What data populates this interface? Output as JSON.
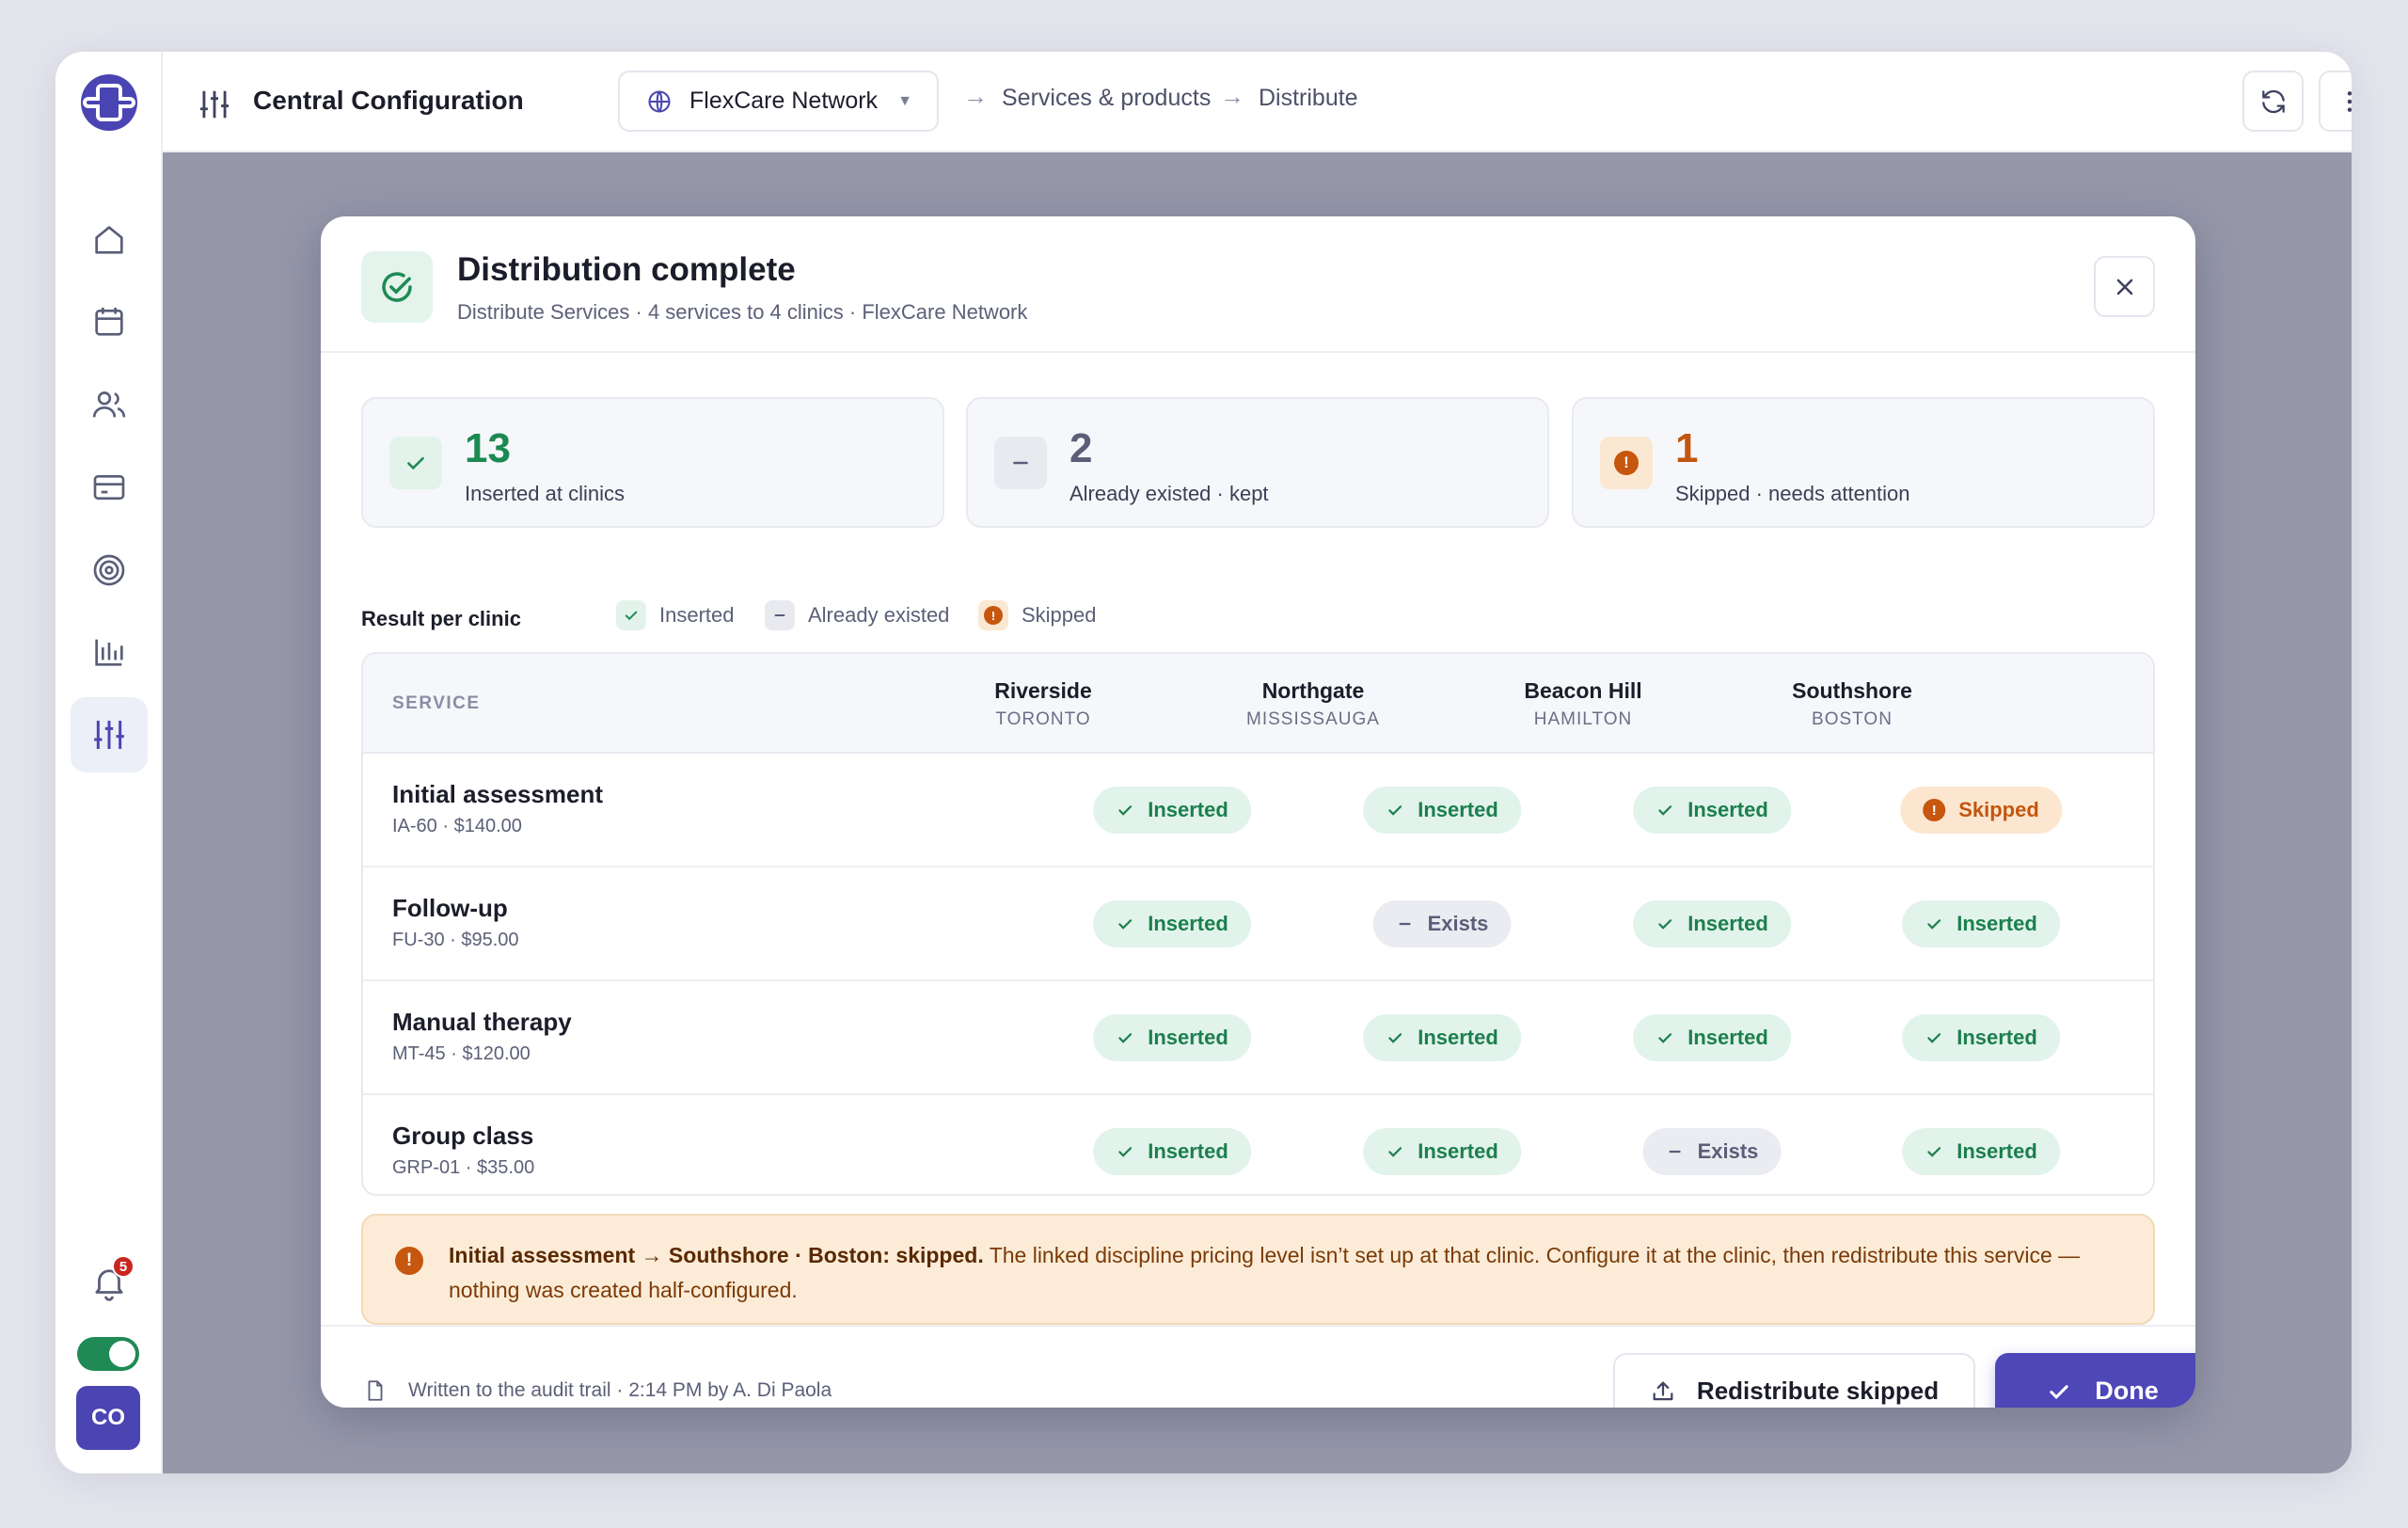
{
  "sidebar": {
    "notification_count": "5",
    "avatar_initials": "CO"
  },
  "topbar": {
    "title": "Central Configuration",
    "network": "FlexCare Network",
    "breadcrumb": [
      "Services & products",
      "Distribute"
    ]
  },
  "modal": {
    "title": "Distribution complete",
    "subtitle": "Distribute Services · 4 services to 4 clinics · FlexCare Network",
    "stats": [
      {
        "value": "13",
        "label": "Inserted at clinics",
        "color": "#1b8a52"
      },
      {
        "value": "2",
        "label": "Already existed · kept",
        "color": "#5a5e78"
      },
      {
        "value": "1",
        "label": "Skipped · needs attention",
        "color": "#c2560e"
      }
    ],
    "legend": {
      "title": "Result per clinic",
      "inserted": "Inserted",
      "exists": "Already existed",
      "skipped": "Skipped"
    },
    "table": {
      "service_header": "SERVICE",
      "clinics": [
        {
          "name": "Riverside",
          "city": "TORONTO"
        },
        {
          "name": "Northgate",
          "city": "MISSISSAUGA"
        },
        {
          "name": "Beacon Hill",
          "city": "HAMILTON"
        },
        {
          "name": "Southshore",
          "city": "BOSTON"
        }
      ],
      "rows": [
        {
          "name": "Initial assessment",
          "meta": "IA-60 · $140.00",
          "results": [
            "Inserted",
            "Inserted",
            "Inserted",
            "Skipped"
          ]
        },
        {
          "name": "Follow-up",
          "meta": "FU-30 · $95.00",
          "results": [
            "Inserted",
            "Exists",
            "Inserted",
            "Inserted"
          ]
        },
        {
          "name": "Manual therapy",
          "meta": "MT-45 · $120.00",
          "results": [
            "Inserted",
            "Inserted",
            "Inserted",
            "Inserted"
          ]
        },
        {
          "name": "Group class",
          "meta": "GRP-01 · $35.00",
          "results": [
            "Inserted",
            "Inserted",
            "Exists",
            "Inserted"
          ]
        }
      ]
    },
    "alert": {
      "bold": "Initial assessment → Southshore · Boston: skipped.",
      "text": " The linked discipline pricing level isn’t set up at that clinic. Configure it at the clinic, then redistribute this service — nothing was created half-configured."
    },
    "footer": {
      "audit": "Written to the audit trail · 2:14 PM by A. Di Paola",
      "redistribute": "Redistribute skipped",
      "done": "Done"
    }
  }
}
